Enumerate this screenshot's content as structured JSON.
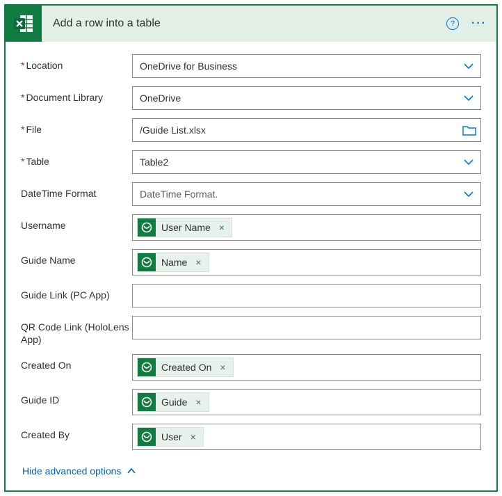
{
  "header": {
    "title": "Add a row into a table"
  },
  "fields": {
    "location": {
      "label": "Location",
      "value": "OneDrive for Business"
    },
    "documentLibrary": {
      "label": "Document Library",
      "value": "OneDrive"
    },
    "file": {
      "label": "File",
      "value": "/Guide List.xlsx"
    },
    "table": {
      "label": "Table",
      "value": "Table2"
    },
    "datetimeFormat": {
      "label": "DateTime Format",
      "placeholder": "DateTime Format."
    },
    "username": {
      "label": "Username",
      "pill": "User Name"
    },
    "guideName": {
      "label": "Guide Name",
      "pill": "Name"
    },
    "guideLink": {
      "label": "Guide Link (PC App)"
    },
    "qrCodeLink": {
      "label": "QR Code Link (HoloLens App)"
    },
    "createdOn": {
      "label": "Created On",
      "pill": "Created On"
    },
    "guideId": {
      "label": "Guide ID",
      "pill": "Guide"
    },
    "createdBy": {
      "label": "Created By",
      "pill": "User"
    }
  },
  "footer": {
    "advancedToggle": "Hide advanced options"
  }
}
